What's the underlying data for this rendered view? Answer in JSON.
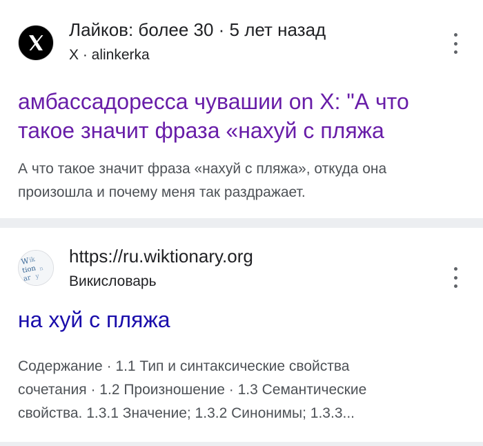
{
  "results": [
    {
      "favicon_icon": "x-logo-icon",
      "source_line1": "Лайков: более 30 · 5 лет назад",
      "source_line2": "X · alinkerka",
      "title_line1": "амбассадоресса чувашии on X: \"А что",
      "title_line2": "такое значит фраза «нахуй с пляжа",
      "snippet_line1": "А что такое значит фраза «нахуй с пляжа», откуда она",
      "snippet_line2": "произошла и почему меня так раздражает.",
      "menu_icon": "more-vert-icon",
      "title_color": "#681da8"
    },
    {
      "favicon_icon": "wiktionary-logo-icon",
      "source_line1": "https://ru.wiktionary.org",
      "source_line2": "Викисловарь",
      "title_line1": "на хуй с пляжа",
      "snippet_line1": "Содержание · 1.1 Тип и синтаксические свойства",
      "snippet_line2": "сочетания · 1.2 Произношение · 1.3 Семантические",
      "snippet_line3": "свойства. 1.3.1 Значение; 1.3.2 Синонимы; 1.3.3...",
      "menu_icon": "more-vert-icon",
      "title_color": "#1a0dab"
    }
  ],
  "colors": {
    "separator": "#eceef1",
    "snippet_text": "#4d5156",
    "source_text": "#202124"
  }
}
